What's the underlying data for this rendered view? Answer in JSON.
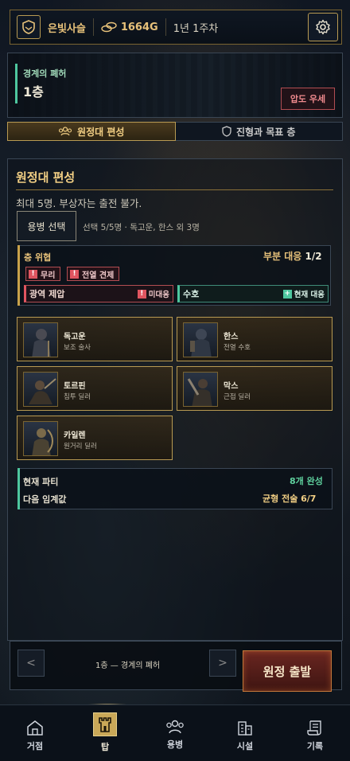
{
  "topbar": {
    "guild_name": "은빛사슬",
    "gold": "1664G",
    "week": "1년 1주차",
    "icons": {
      "guild": "shield-icon",
      "gold": "coins-icon",
      "settings": "gear-icon"
    }
  },
  "location": {
    "subtitle": "경계의 폐허",
    "floor": "1층",
    "danger_label": "압도 우세"
  },
  "tabs": [
    {
      "label": "원정대 편성",
      "icon": "party-icon",
      "active": true
    },
    {
      "label": "진형과 목표 층",
      "icon": "shield-icon",
      "active": false
    }
  ],
  "formation": {
    "title": "원정대 편성",
    "description": "최대 5명. 부상자는 출전 불가.",
    "select_button": "용병 선택",
    "selection_info": "선택 5/5명 · 독고운, 한스 외 3명"
  },
  "threat": {
    "label": "층 위협",
    "status": "부분 대응",
    "count": "1/2",
    "tags": [
      "무리",
      "전열 견제"
    ],
    "counters": [
      {
        "name": "광역 제압",
        "status": "미대응",
        "state": "unmet",
        "color": "#e05560"
      },
      {
        "name": "수호",
        "status": "현재 대응",
        "state": "met",
        "color": "#4ec79f"
      }
    ]
  },
  "mercenaries": [
    {
      "name": "독고운",
      "role": "보조 술사"
    },
    {
      "name": "한스",
      "role": "전열 수호"
    },
    {
      "name": "토르핀",
      "role": "침투 딜러"
    },
    {
      "name": "막스",
      "role": "근접 딜러"
    },
    {
      "name": "카일렌",
      "role": "원거리 딜러"
    }
  ],
  "party": {
    "current_label": "현재 파티",
    "current_value": "8개 완성",
    "next_label": "다음 임계값",
    "next_value": "균형 전술 6/7"
  },
  "action": {
    "prev_label": "<",
    "next_label": ">",
    "floor_label": "1층 — 경계의 폐허",
    "launch_label": "원정 출발"
  },
  "bottom_nav": [
    {
      "label": "거점",
      "icon": "home-icon",
      "active": false
    },
    {
      "label": "탑",
      "icon": "tower-icon",
      "active": true
    },
    {
      "label": "용병",
      "icon": "party-icon",
      "active": false
    },
    {
      "label": "시설",
      "icon": "building-icon",
      "active": false
    },
    {
      "label": "기록",
      "icon": "scroll-icon",
      "active": false
    }
  ],
  "colors": {
    "gold": "#e8c27a",
    "accent_green": "#4ec79f",
    "danger_red": "#e05560",
    "card_border": "#b89a52"
  }
}
